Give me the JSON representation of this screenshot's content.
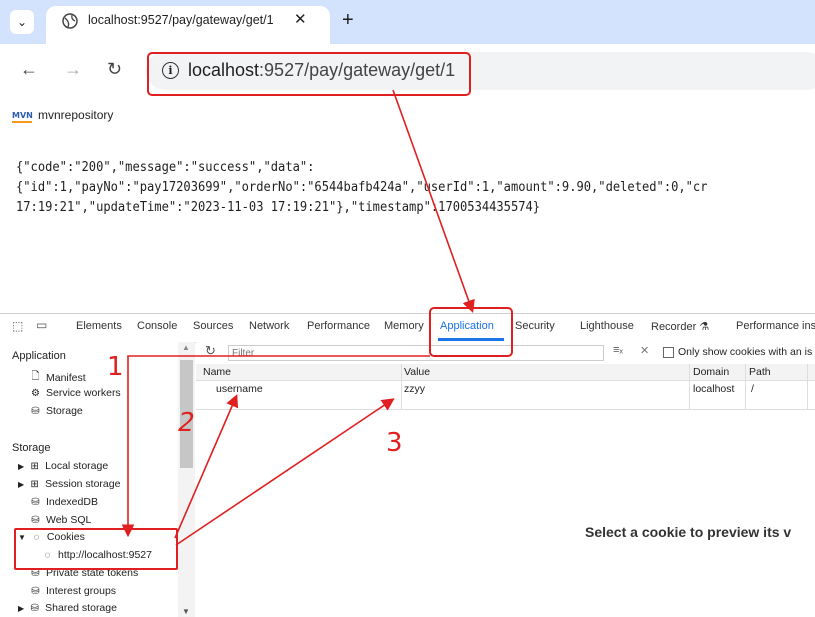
{
  "browser": {
    "tab_title": "localhost:9527/pay/gateway/get/1",
    "url_host": "localhost",
    "url_rest": ":9527/pay/gateway/get/1",
    "bookmark_icon_text": "MVN",
    "bookmark_label": "mvnrepository"
  },
  "json_lines": [
    "{\"code\":\"200\",\"message\":\"success\",\"data\":",
    "{\"id\":1,\"payNo\":\"pay17203699\",\"orderNo\":\"6544bafb424a\",\"userId\":1,\"amount\":9.90,\"deleted\":0,\"cr",
    "17:19:21\",\"updateTime\":\"2023-11-03 17:19:21\"},\"timestamp\":1700534435574}"
  ],
  "devtools": {
    "tabs": [
      "Elements",
      "Console",
      "Sources",
      "Network",
      "Performance",
      "Memory",
      "Application",
      "Security",
      "Lighthouse",
      "Recorder",
      "Performance insi"
    ],
    "sidebar": {
      "application_head": "Application",
      "manifest": "Manifest",
      "service_workers": "Service workers",
      "storage_item": "Storage",
      "storage_head": "Storage",
      "local_storage": "Local storage",
      "session_storage": "Session storage",
      "indexeddb": "IndexedDB",
      "websql": "Web SQL",
      "cookies": "Cookies",
      "cookie_origin": "http://localhost:9527",
      "private_tokens": "Private state tokens",
      "interest_groups": "Interest groups",
      "shared_storage": "Shared storage"
    },
    "filter_placeholder": "Filter",
    "only_show_label": "Only show cookies with an is",
    "columns": [
      "Name",
      "Value",
      "Domain",
      "Path"
    ],
    "cookie": {
      "name": "username",
      "value": "zzyy",
      "domain": "localhost",
      "path": "/"
    },
    "preview_text": "Select a cookie to preview its v"
  },
  "annotations": {
    "one": "1",
    "two": "2",
    "three": "3"
  },
  "colors": {
    "annotation": "#e02020",
    "accent": "#1a73e8"
  }
}
